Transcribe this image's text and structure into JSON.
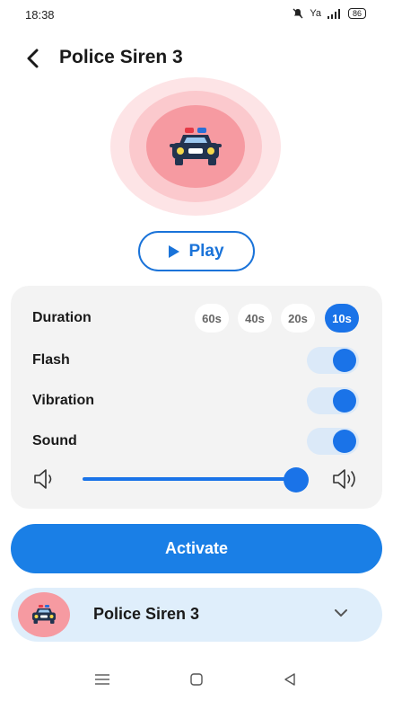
{
  "status_bar": {
    "time": "18:38",
    "signal_label": "Ya",
    "battery": "86"
  },
  "header": {
    "title": "Police Siren 3"
  },
  "icons": {
    "back": "back-arrow-icon",
    "car": "police-car-icon",
    "play": "play-icon",
    "volume_low": "volume-low-icon",
    "volume_high": "volume-high-icon",
    "chevron": "chevron-down-icon"
  },
  "play_button": {
    "label": "Play"
  },
  "settings": {
    "duration_label": "Duration",
    "duration_options": [
      "60s",
      "40s",
      "20s",
      "10s"
    ],
    "duration_selected": "10s",
    "flash_label": "Flash",
    "flash_on": true,
    "vibration_label": "Vibration",
    "vibration_on": true,
    "sound_label": "Sound",
    "sound_on": true,
    "volume_level": 1.0
  },
  "activate_button": {
    "label": "Activate"
  },
  "sound_selector": {
    "label": "Police Siren 3"
  },
  "colors": {
    "accent": "#1a73e8",
    "siren_pink": "#f69aa1",
    "card_bg": "#f3f3f3",
    "selector_bg": "#dfeefb"
  }
}
